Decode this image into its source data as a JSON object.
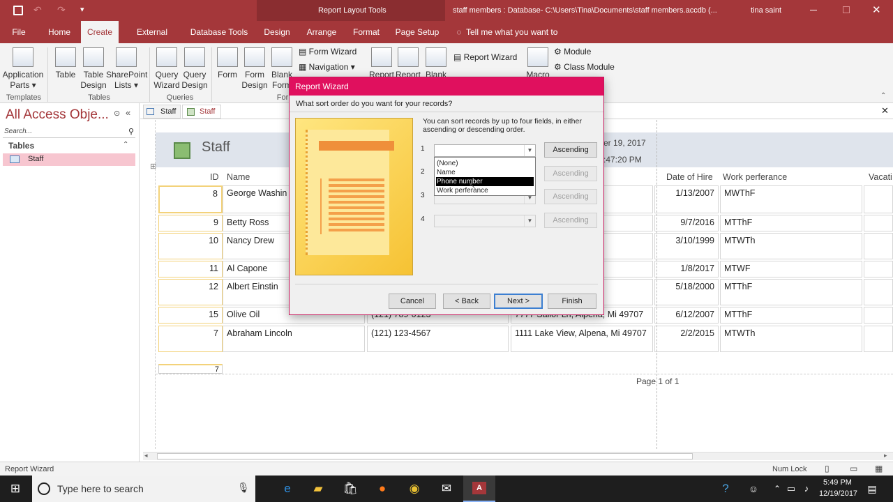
{
  "titlebar": {
    "context_tools": "Report Layout Tools",
    "title": "staff members : Database- C:\\Users\\Tina\\Documents\\staff members.accdb (...",
    "user": "tina saint"
  },
  "ribbon_tabs": [
    "File",
    "Home",
    "Create",
    "External Data",
    "Database Tools",
    "Design",
    "Arrange",
    "Format",
    "Page Setup"
  ],
  "tell_me": "Tell me what you want to do",
  "ribbon": {
    "templates": {
      "app_parts": "Application Parts ▾",
      "group": "Templates"
    },
    "tables": {
      "table": "Table",
      "table_design": "Table Design",
      "sharepoint": "SharePoint Lists ▾",
      "group": "Tables"
    },
    "queries": {
      "wizard": "Query Wizard",
      "design": "Query Design",
      "group": "Queries"
    },
    "forms": {
      "form": "Form",
      "form_design": "Form Design",
      "blank": "Blank Form",
      "form_wizard": "Form Wizard",
      "navigation": "Navigation ▾",
      "group": "For"
    },
    "reports": {
      "report": "Report",
      "report_design": "Report",
      "blank": "Blank",
      "report_wizard": "Report Wizard"
    },
    "macros": {
      "macro": "Macro",
      "module": "Module",
      "class_module": "Class Module"
    }
  },
  "nav": {
    "title": "All Access Obje...",
    "search_placeholder": "Search...",
    "section": "Tables",
    "item": "Staff"
  },
  "doc_tabs": [
    "Staff",
    "Staff"
  ],
  "report": {
    "title": "Staff",
    "date": "er 19, 2017",
    "time": ":47:20 PM",
    "headers": {
      "id": "ID",
      "name": "Name",
      "hire": "Date of Hire",
      "work": "Work perferance",
      "vac": "Vacati"
    },
    "rows": [
      {
        "id": "8",
        "name": "George Washin",
        "phone": "",
        "addr": ", Mi 49707",
        "hire": "1/13/2007",
        "work": "MWThF"
      },
      {
        "id": "9",
        "name": "Betty Ross",
        "phone": "",
        "addr": "Mi 49707",
        "hire": "9/7/2016",
        "work": "MTThF"
      },
      {
        "id": "10",
        "name": "Nancy Drew",
        "phone": "",
        "addr": "na, Mi",
        "hire": "3/10/1999",
        "work": "MTWTh"
      },
      {
        "id": "11",
        "name": "Al Capone",
        "phone": "",
        "addr": "Mi 49707",
        "hire": "1/8/2017",
        "work": "MTWF"
      },
      {
        "id": "12",
        "name": "Albert Einstin",
        "phone": "",
        "addr": ", Mi 49707",
        "hire": "5/18/2000",
        "work": "MTThF"
      },
      {
        "id": "15",
        "name": "Olive Oil",
        "phone": "(121) 789-0123",
        "addr": "7777 Sailor Ln, Alpena, Mi 49707",
        "hire": "6/12/2007",
        "work": "MTThF"
      },
      {
        "id": "7",
        "name": "Abraham Lincoln",
        "phone": "(121) 123-4567",
        "addr": "1111 Lake View, Alpena, Mi 49707",
        "hire": "2/2/2015",
        "work": "MTWTh"
      }
    ],
    "count": "7",
    "page": "Page 1 of 1"
  },
  "dialog": {
    "title": "Report Wizard",
    "question": "What sort order do you want for your records?",
    "info": "You can sort records by up to four fields, in either ascending or descending order.",
    "numbers": [
      "1",
      "2",
      "3",
      "4"
    ],
    "ascending": "Ascending",
    "dropdown": [
      "(None)",
      "Name",
      "Phone number",
      "Work perferance"
    ],
    "buttons": {
      "cancel": "Cancel",
      "back": "< Back",
      "next": "Next >",
      "finish": "Finish"
    }
  },
  "status": {
    "left": "Report Wizard",
    "numlock": "Num Lock"
  },
  "taskbar": {
    "search": "Type here to search",
    "time": "5:49 PM",
    "date": "12/19/2017"
  },
  "colors": {
    "access_red": "#a4373a",
    "dialog_title": "#e0105e",
    "highlight": "#f7c6d0"
  }
}
